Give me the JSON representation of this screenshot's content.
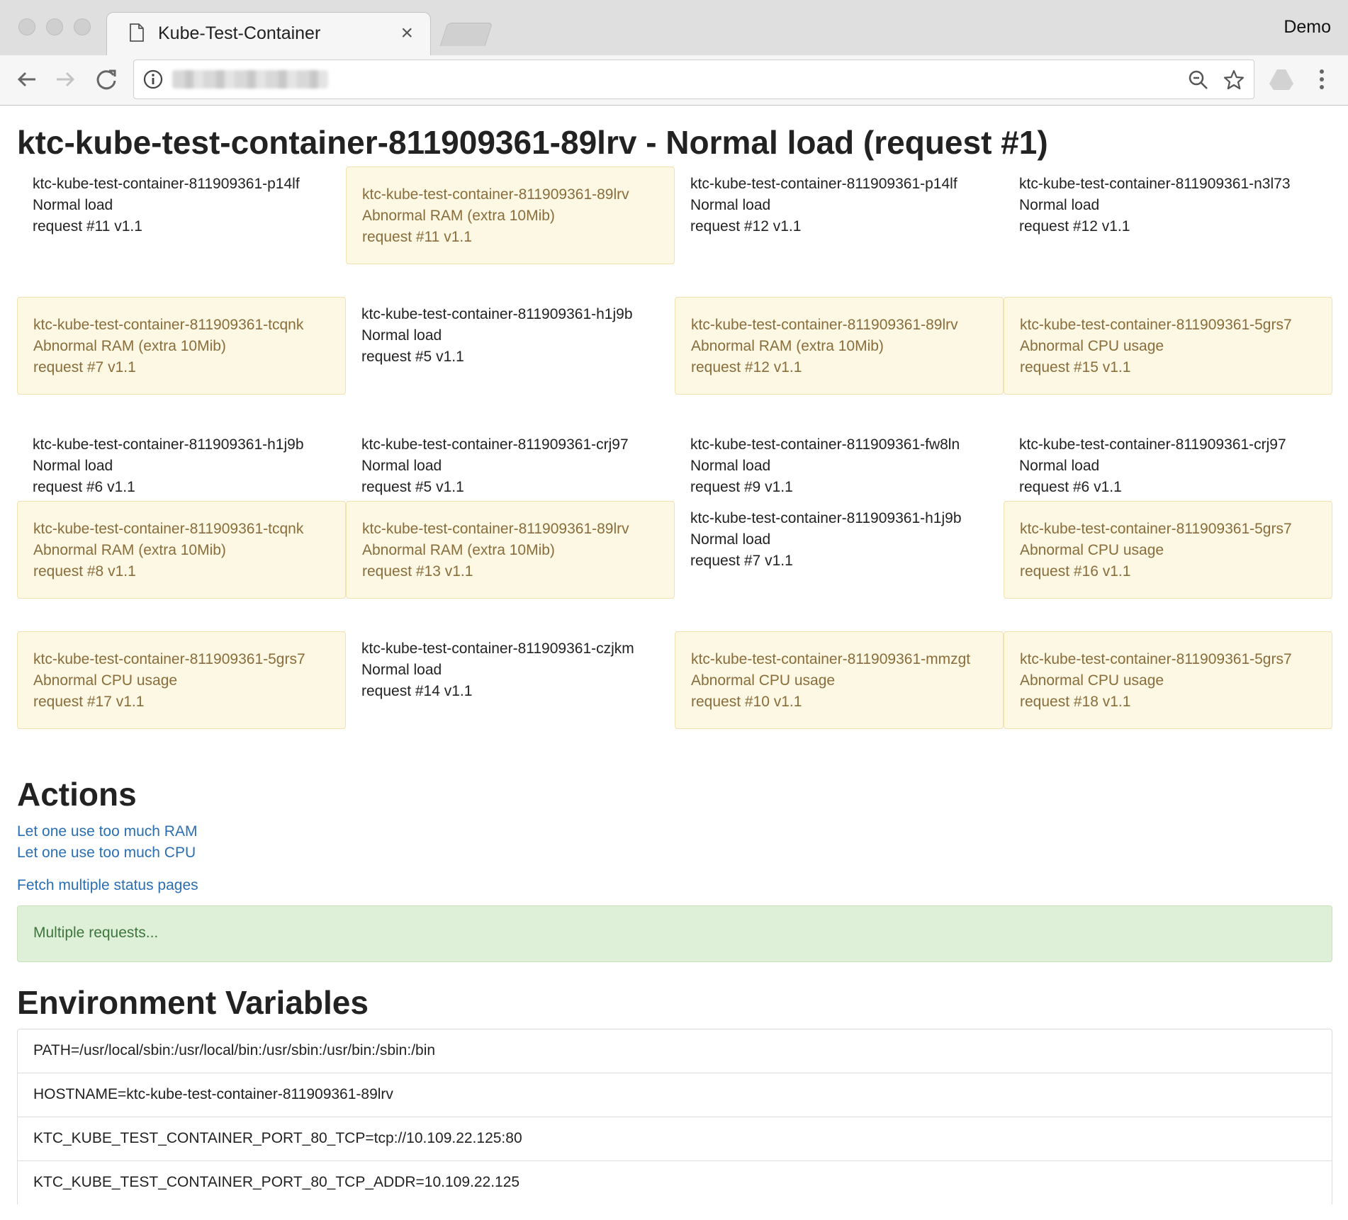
{
  "browser": {
    "tab_title": "Kube-Test-Container",
    "profile_name": "Demo",
    "icons": [
      "back-icon",
      "forward-icon",
      "reload-icon",
      "info-icon",
      "zoom-icon",
      "star-icon",
      "drive-extension-icon",
      "menu-icon"
    ]
  },
  "page": {
    "title": "ktc-kube-test-container-811909361-89lrv - Normal load (request #1)"
  },
  "grid": [
    {
      "host": "ktc-kube-test-container-811909361-p14lf",
      "status": "Normal load",
      "request": "request #11 v1.1",
      "state": "normal"
    },
    {
      "host": "ktc-kube-test-container-811909361-89lrv",
      "status": "Abnormal RAM (extra 10Mib)",
      "request": "request #11 v1.1",
      "state": "warning"
    },
    {
      "host": "ktc-kube-test-container-811909361-p14lf",
      "status": "Normal load",
      "request": "request #12 v1.1",
      "state": "normal"
    },
    {
      "host": "ktc-kube-test-container-811909361-n3l73",
      "status": "Normal load",
      "request": "request #12 v1.1",
      "state": "normal"
    },
    {
      "host": "ktc-kube-test-container-811909361-tcqnk",
      "status": "Abnormal RAM (extra 10Mib)",
      "request": "request #7 v1.1",
      "state": "warning"
    },
    {
      "host": "ktc-kube-test-container-811909361-h1j9b",
      "status": "Normal load",
      "request": "request #5 v1.1",
      "state": "normal"
    },
    {
      "host": "ktc-kube-test-container-811909361-89lrv",
      "status": "Abnormal RAM (extra 10Mib)",
      "request": "request #12 v1.1",
      "state": "warning"
    },
    {
      "host": "ktc-kube-test-container-811909361-5grs7",
      "status": "Abnormal CPU usage",
      "request": "request #15 v1.1",
      "state": "warning"
    },
    {
      "host": "ktc-kube-test-container-811909361-h1j9b",
      "status": "Normal load",
      "request": "request #6 v1.1",
      "state": "normal"
    },
    {
      "host": "ktc-kube-test-container-811909361-crj97",
      "status": "Normal load",
      "request": "request #5 v1.1",
      "state": "normal"
    },
    {
      "host": "ktc-kube-test-container-811909361-fw8ln",
      "status": "Normal load",
      "request": "request #9 v1.1",
      "state": "normal"
    },
    {
      "host": "ktc-kube-test-container-811909361-crj97",
      "status": "Normal load",
      "request": "request #6 v1.1",
      "state": "normal"
    },
    {
      "host": "ktc-kube-test-container-811909361-tcqnk",
      "status": "Abnormal RAM (extra 10Mib)",
      "request": "request #8 v1.1",
      "state": "warning"
    },
    {
      "host": "ktc-kube-test-container-811909361-89lrv",
      "status": "Abnormal RAM (extra 10Mib)",
      "request": "request #13 v1.1",
      "state": "warning"
    },
    {
      "host": "ktc-kube-test-container-811909361-h1j9b",
      "status": "Normal load",
      "request": "request #7 v1.1",
      "state": "normal"
    },
    {
      "host": "ktc-kube-test-container-811909361-5grs7",
      "status": "Abnormal CPU usage",
      "request": "request #16 v1.1",
      "state": "warning"
    },
    {
      "host": "ktc-kube-test-container-811909361-5grs7",
      "status": "Abnormal CPU usage",
      "request": "request #17 v1.1",
      "state": "warning"
    },
    {
      "host": "ktc-kube-test-container-811909361-czjkm",
      "status": "Normal load",
      "request": "request #14 v1.1",
      "state": "normal"
    },
    {
      "host": "ktc-kube-test-container-811909361-mmzgt",
      "status": "Abnormal CPU usage",
      "request": "request #10 v1.1",
      "state": "warning"
    },
    {
      "host": "ktc-kube-test-container-811909361-5grs7",
      "status": "Abnormal CPU usage",
      "request": "request #18 v1.1",
      "state": "warning"
    }
  ],
  "actions": {
    "title": "Actions",
    "ram_link": "Let one use too much RAM",
    "cpu_link": "Let one use too much CPU",
    "fetch_link": "Fetch multiple status pages",
    "status_message": "Multiple requests..."
  },
  "env": {
    "title": "Environment Variables",
    "items": [
      "PATH=/usr/local/sbin:/usr/local/bin:/usr/sbin:/usr/bin:/sbin:/bin",
      "HOSTNAME=ktc-kube-test-container-811909361-89lrv",
      "KTC_KUBE_TEST_CONTAINER_PORT_80_TCP=tcp://10.109.22.125:80",
      "KTC_KUBE_TEST_CONTAINER_PORT_80_TCP_ADDR=10.109.22.125"
    ]
  },
  "colors": {
    "warning_bg": "#fcf8e3",
    "warning_text": "#8a6d3b",
    "success_bg": "#dff0d8",
    "success_text": "#3c763d",
    "link": "#2a6fb3"
  }
}
